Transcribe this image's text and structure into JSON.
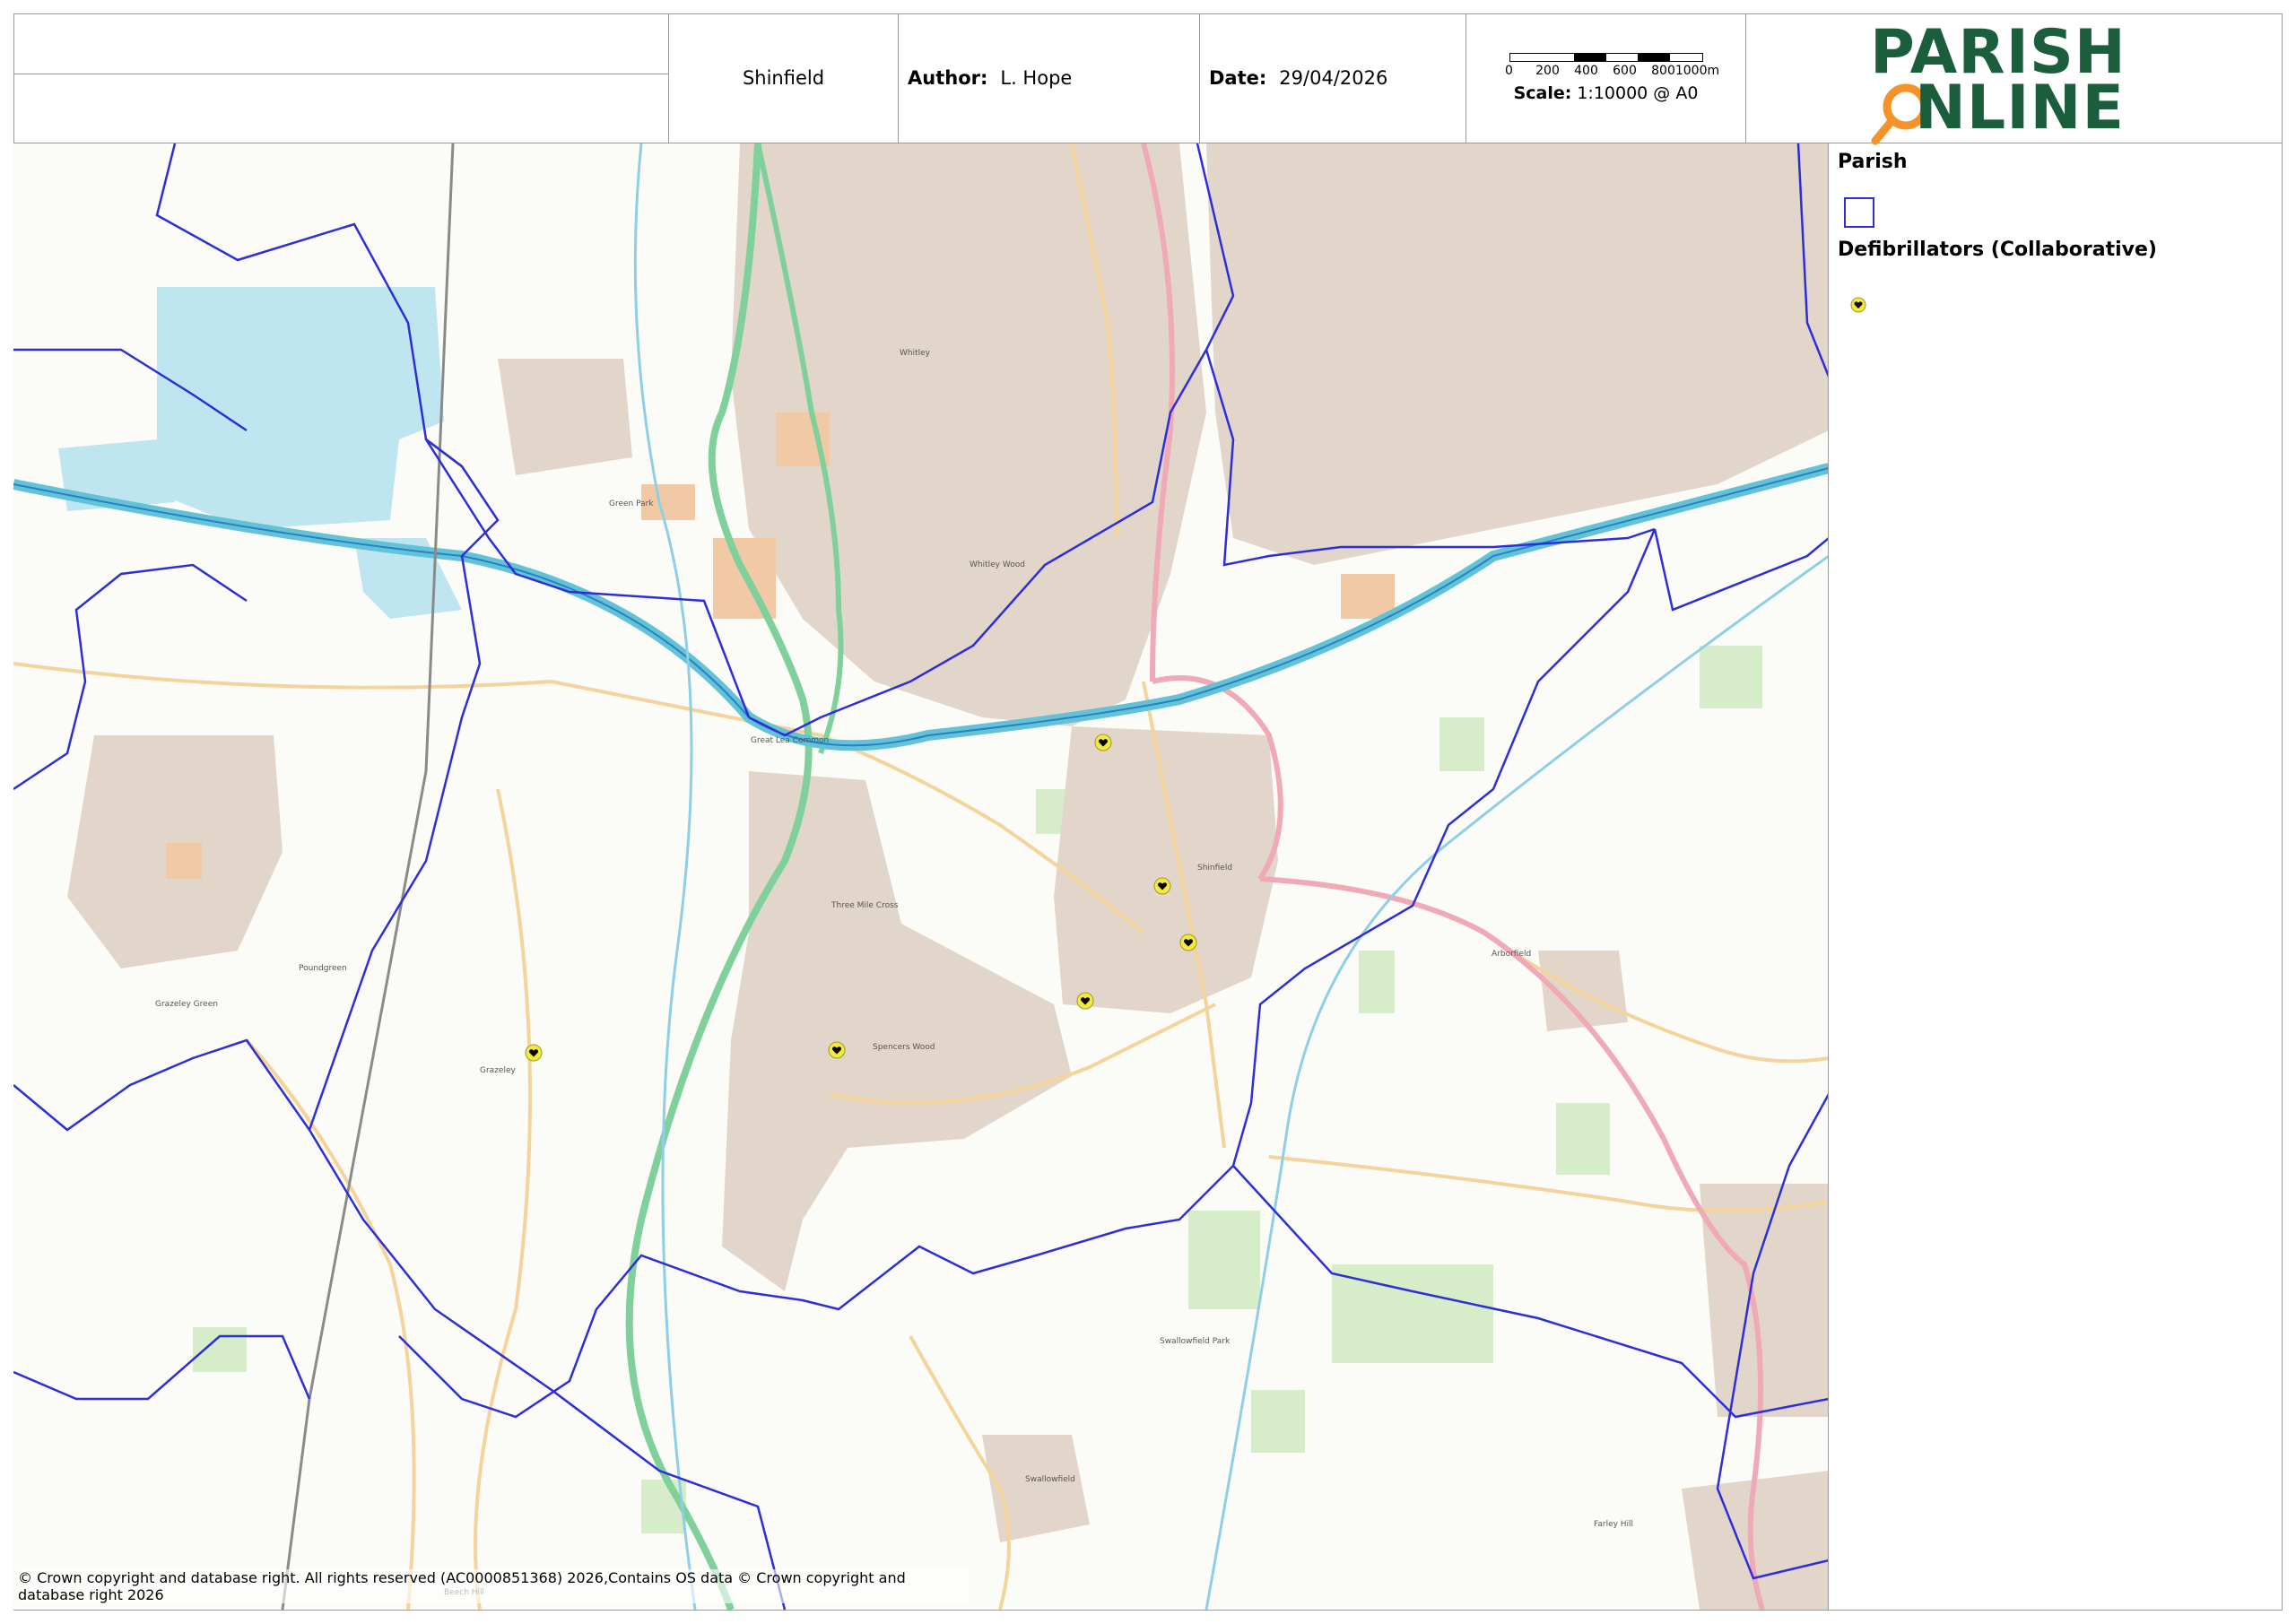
{
  "header": {
    "parish_name": "Shinfield",
    "author_label": "Author:",
    "author": "L. Hope",
    "date_label": "Date:",
    "date": "29/04/2026",
    "scale_label": "Scale:",
    "scale": "1:10000 @ A0",
    "scale_ticks": [
      "0",
      "200",
      "400",
      "600",
      "800",
      "1000m"
    ],
    "logo_line1": "PARISH",
    "logo_line2": "NLINE"
  },
  "legend": {
    "parish_heading": "Parish",
    "defib_heading": "Defibrillators (Collaborative)"
  },
  "map": {
    "copyright": "© Crown copyright and database right. All rights reserved (AC0000851368) 2026,Contains OS data © Crown copyright and database right 2026",
    "place_labels": [
      "Whitley",
      "Whitley Wood",
      "Green Park",
      "Great Lea Common",
      "Three Mile Cross",
      "Spencers Wood",
      "Shinfield",
      "Arborfield",
      "Swallowfield Park",
      "Swallowfield",
      "Grazeley",
      "Grazeley Green",
      "Farley Hill",
      "Beech Hill",
      "Poundgreen"
    ],
    "defibrillator_count": 7
  },
  "colors": {
    "parish_boundary": "#2d2ed8",
    "motorway": "#62c3d6",
    "a_road": "#7fd09a",
    "b_road": "#f2a7b4",
    "urban": "#d8cfc6",
    "water": "#a8dcea",
    "woodland": "#cfe8c3",
    "defib_marker": "#f3ea3a",
    "logo_green": "#1b5e3b",
    "logo_orange": "#f3932a"
  },
  "icons": {
    "defibrillator": "heart-pin-icon",
    "logo_magnifier": "magnifier-icon"
  }
}
